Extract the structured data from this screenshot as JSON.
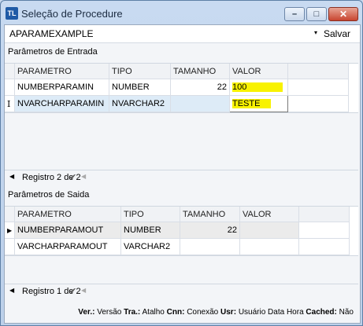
{
  "window": {
    "app_icon": "TL",
    "title": "Seleção de Procedure",
    "min_glyph": "–",
    "max_glyph": "□",
    "close_glyph": "✕"
  },
  "procedure": {
    "selected": "APARAMEXAMPLE",
    "dropdown_icon": "▾",
    "save_label": "Salvar"
  },
  "input": {
    "section_label": "Parâmetros de Entrada",
    "columns": [
      "PARAMETRO",
      "TIPO",
      "TAMANHO",
      "VALOR"
    ],
    "rows": [
      {
        "indicator": "",
        "parametro": "NUMBERPARAMIN",
        "tipo": "NUMBER",
        "tamanho": "22",
        "valor": "100"
      },
      {
        "indicator": "I",
        "parametro": "NVARCHARPARAMIN",
        "tipo": "NVARCHAR2",
        "tamanho": "",
        "valor": "TESTE"
      }
    ],
    "nav": {
      "left_arrow": "◀",
      "record_text": "Registro 2 de 2",
      "check": "✔",
      "right_arrow": "◀"
    }
  },
  "output": {
    "section_label": "Parâmetros de Saida",
    "columns": [
      "PARAMETRO",
      "TIPO",
      "TAMANHO",
      "VALOR"
    ],
    "rows": [
      {
        "indicator": "▶",
        "parametro": "NUMBERPARAMOUT",
        "tipo": "NUMBER",
        "tamanho": "22",
        "valor": ""
      },
      {
        "indicator": "",
        "parametro": "VARCHARPARAMOUT",
        "tipo": "VARCHAR2",
        "tamanho": "",
        "valor": ""
      }
    ],
    "nav": {
      "left_arrow": "◀",
      "record_text": "Registro 1 de 2",
      "check": "✔",
      "right_arrow": "◀"
    }
  },
  "status_bar": {
    "ver_label": "Ver.:",
    "ver_value": "Versão",
    "tra_label": "Tra.:",
    "tra_value": "Atalho",
    "cnn_label": "Cnn:",
    "cnn_value": "Conexão",
    "usr_label": "Usr:",
    "usr_value": "Usuário Data Hora",
    "cached_label": "Cached:",
    "cached_value": "Não"
  },
  "colors": {
    "highlight": "#f8f200",
    "selected_row": "#ddebf7"
  }
}
